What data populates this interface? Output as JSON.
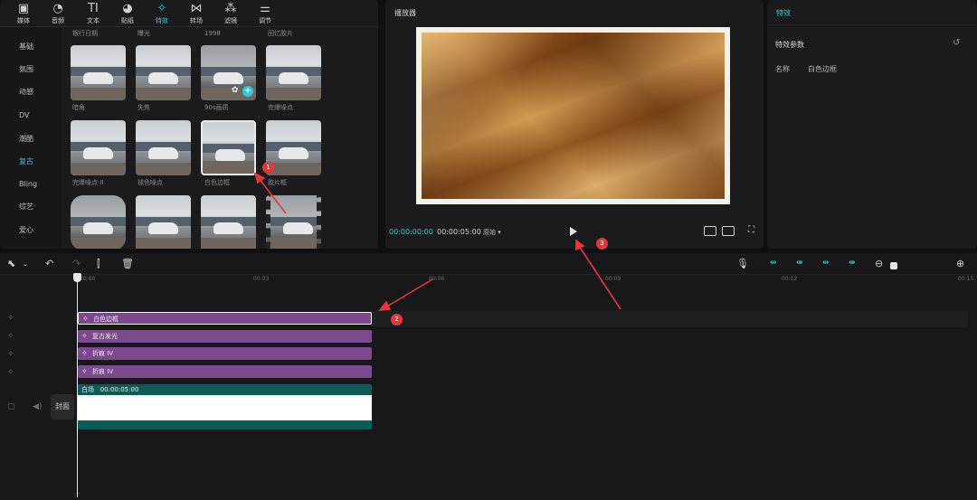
{
  "toolbar": {
    "items": [
      {
        "label": "媒体",
        "icon": "media-icon"
      },
      {
        "label": "音频",
        "icon": "audio-icon"
      },
      {
        "label": "文本",
        "icon": "text-icon"
      },
      {
        "label": "贴纸",
        "icon": "sticker-icon"
      },
      {
        "label": "特效",
        "icon": "effects-icon"
      },
      {
        "label": "转场",
        "icon": "transition-icon"
      },
      {
        "label": "滤镜",
        "icon": "filter-icon"
      },
      {
        "label": "调节",
        "icon": "adjust-icon"
      }
    ],
    "active": "特效"
  },
  "categories": [
    "基础",
    "氛围",
    "动感",
    "DV",
    "潮酷",
    "复古",
    "Bling",
    "综艺",
    "爱心"
  ],
  "active_category": "复古",
  "effects_top_row_labels": [
    "银行日期",
    "曝光",
    "1998",
    "回忆胶片"
  ],
  "effects": [
    {
      "label": "暗角"
    },
    {
      "label": "失焦"
    },
    {
      "label": "90s画质"
    },
    {
      "label": "完爆噪点"
    },
    {
      "label": "完爆噪点 II"
    },
    {
      "label": "褪色噪点"
    },
    {
      "label": "白色边框"
    },
    {
      "label": "胶片框"
    }
  ],
  "player": {
    "title": "播放器",
    "current_time": "00:00:00:00",
    "total_time": "00:00:05:00",
    "ratio_label": "原始"
  },
  "fx_panel": {
    "tab": "特效",
    "section": "特效参数",
    "name_label": "名称",
    "name_value": "白色边框"
  },
  "timeline": {
    "ruler": [
      "00:00",
      "00:03",
      "00:06",
      "00:09",
      "00:12",
      "00:15"
    ],
    "effect_tracks": [
      "白色边框",
      "复古发光",
      "折痕 IV",
      "折痕 IV"
    ],
    "video_clip": {
      "name": "白场",
      "duration": "00:00:05:00"
    },
    "cover_label": "封面"
  },
  "annotations": [
    "1",
    "2",
    "3"
  ],
  "colors": {
    "accent": "#37c6d2",
    "effect_track": "#7a4a8c",
    "video_track": "#0e5a57",
    "badge": "#e0383e"
  }
}
